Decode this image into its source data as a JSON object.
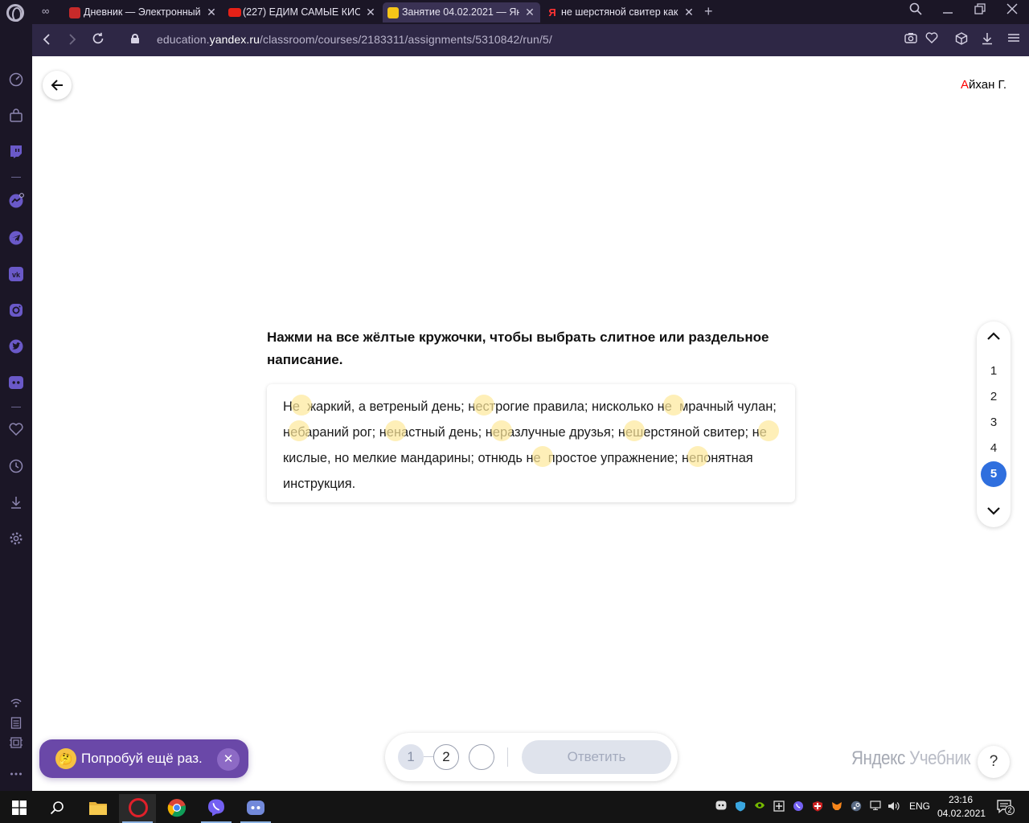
{
  "browser": {
    "tabs": [
      {
        "title": "Дневник — Электронный",
        "favicon_color": "#c72a2a",
        "active": false
      },
      {
        "title": "(227) ЕДИМ САМЫЕ КИСЛ",
        "favicon_color": "#e62117",
        "active": false
      },
      {
        "title": "Занятие 04.02.2021 — Янд",
        "favicon_color": "#f5c518",
        "active": true
      },
      {
        "title": "не шерстяной свитер как",
        "favicon_color": "#ff3333",
        "active": false
      }
    ],
    "tab_close_glyph": "✕",
    "new_tab_glyph": "+",
    "url": {
      "prefix": "education.",
      "host": "yandex.ru",
      "path": "/classroom/courses/2183311/assignments/5310842/run/5/"
    }
  },
  "page": {
    "user": {
      "first_letter": "А",
      "rest": "йхан Г."
    },
    "task": {
      "instruction": "Нажми на все жёлтые кружочки, чтобы выбрать слитное или раздельное написание.",
      "segments": [
        {
          "pre": "Н",
          "hl": "е",
          "post": "жаркий, а ветреный день; ",
          "space": true
        },
        {
          "pre": "н",
          "hl": "е",
          "post": "строгие правила; нисколько",
          "space": false
        },
        {
          "pre": "н",
          "hl": "е",
          "post": "мрачный чулан; ",
          "space": true
        },
        {
          "pre": "н",
          "hl": "е",
          "post": "бараний рог; ",
          "space": false
        },
        {
          "pre": "н",
          "hl": "е",
          "post": "настный день; ",
          "space": false
        },
        {
          "pre": "н",
          "hl": "е",
          "post": "разлучные друзья; ",
          "space": false
        },
        {
          "pre": "н",
          "hl": "е",
          "post": "шерстяной свитер; ",
          "space": false
        },
        {
          "pre": "н",
          "hl": "е",
          "post": "кислые, но мелкие мандарины; отнюдь",
          "space": false
        },
        {
          "pre": "н",
          "hl": "е",
          "post": "простое упражнение; ",
          "space": true
        },
        {
          "pre": "н",
          "hl": "е",
          "post": "понятная инструкция.",
          "space": false
        }
      ]
    },
    "progress": {
      "items": [
        "1",
        "2",
        "3",
        "4",
        "5"
      ],
      "current": "5"
    },
    "attempts": [
      "1",
      "2",
      ""
    ],
    "submit_label": "Ответить",
    "toast": {
      "emoji": "🤔",
      "text": "Попробуй ещё раз.",
      "close_glyph": "✕"
    },
    "brand": {
      "part1": "Яндекс",
      "part2": "Учебник"
    },
    "help_label": "?"
  },
  "taskbar": {
    "lang": "ENG",
    "time": "23:16",
    "date": "04.02.2021",
    "notifications": "2"
  },
  "colors": {
    "accent": "#2f6fde",
    "highlight": "#fde89a",
    "toast": "#6a48a8",
    "user_initial": "#ff0000"
  }
}
